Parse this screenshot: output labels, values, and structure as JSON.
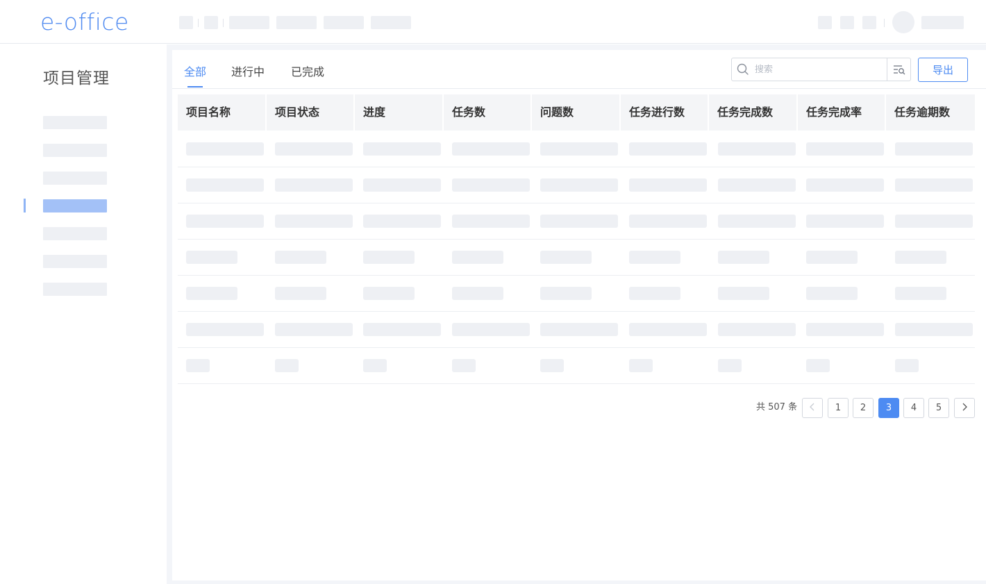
{
  "header": {
    "logo": "e-office"
  },
  "sidebar": {
    "title": "项目管理",
    "active_index": 3
  },
  "tabs": [
    {
      "label": "全部",
      "active": true
    },
    {
      "label": "进行中",
      "active": false
    },
    {
      "label": "已完成",
      "active": false
    }
  ],
  "toolbar": {
    "search_placeholder": "搜索",
    "export_label": "导出"
  },
  "table": {
    "columns": [
      "项目名称",
      "项目状态",
      "进度",
      "任务数",
      "问题数",
      "任务进行数",
      "任务完成数",
      "任务完成率",
      "任务逾期数"
    ],
    "row_count": 7
  },
  "pagination": {
    "total_text": "共 507 条",
    "prev_icon": "‹",
    "next_icon": "›",
    "pages": [
      "1",
      "2",
      "3",
      "4",
      "5"
    ],
    "current": "3"
  },
  "colors": {
    "accent": "#4d8bf2",
    "placeholder": "#eef0f4"
  }
}
